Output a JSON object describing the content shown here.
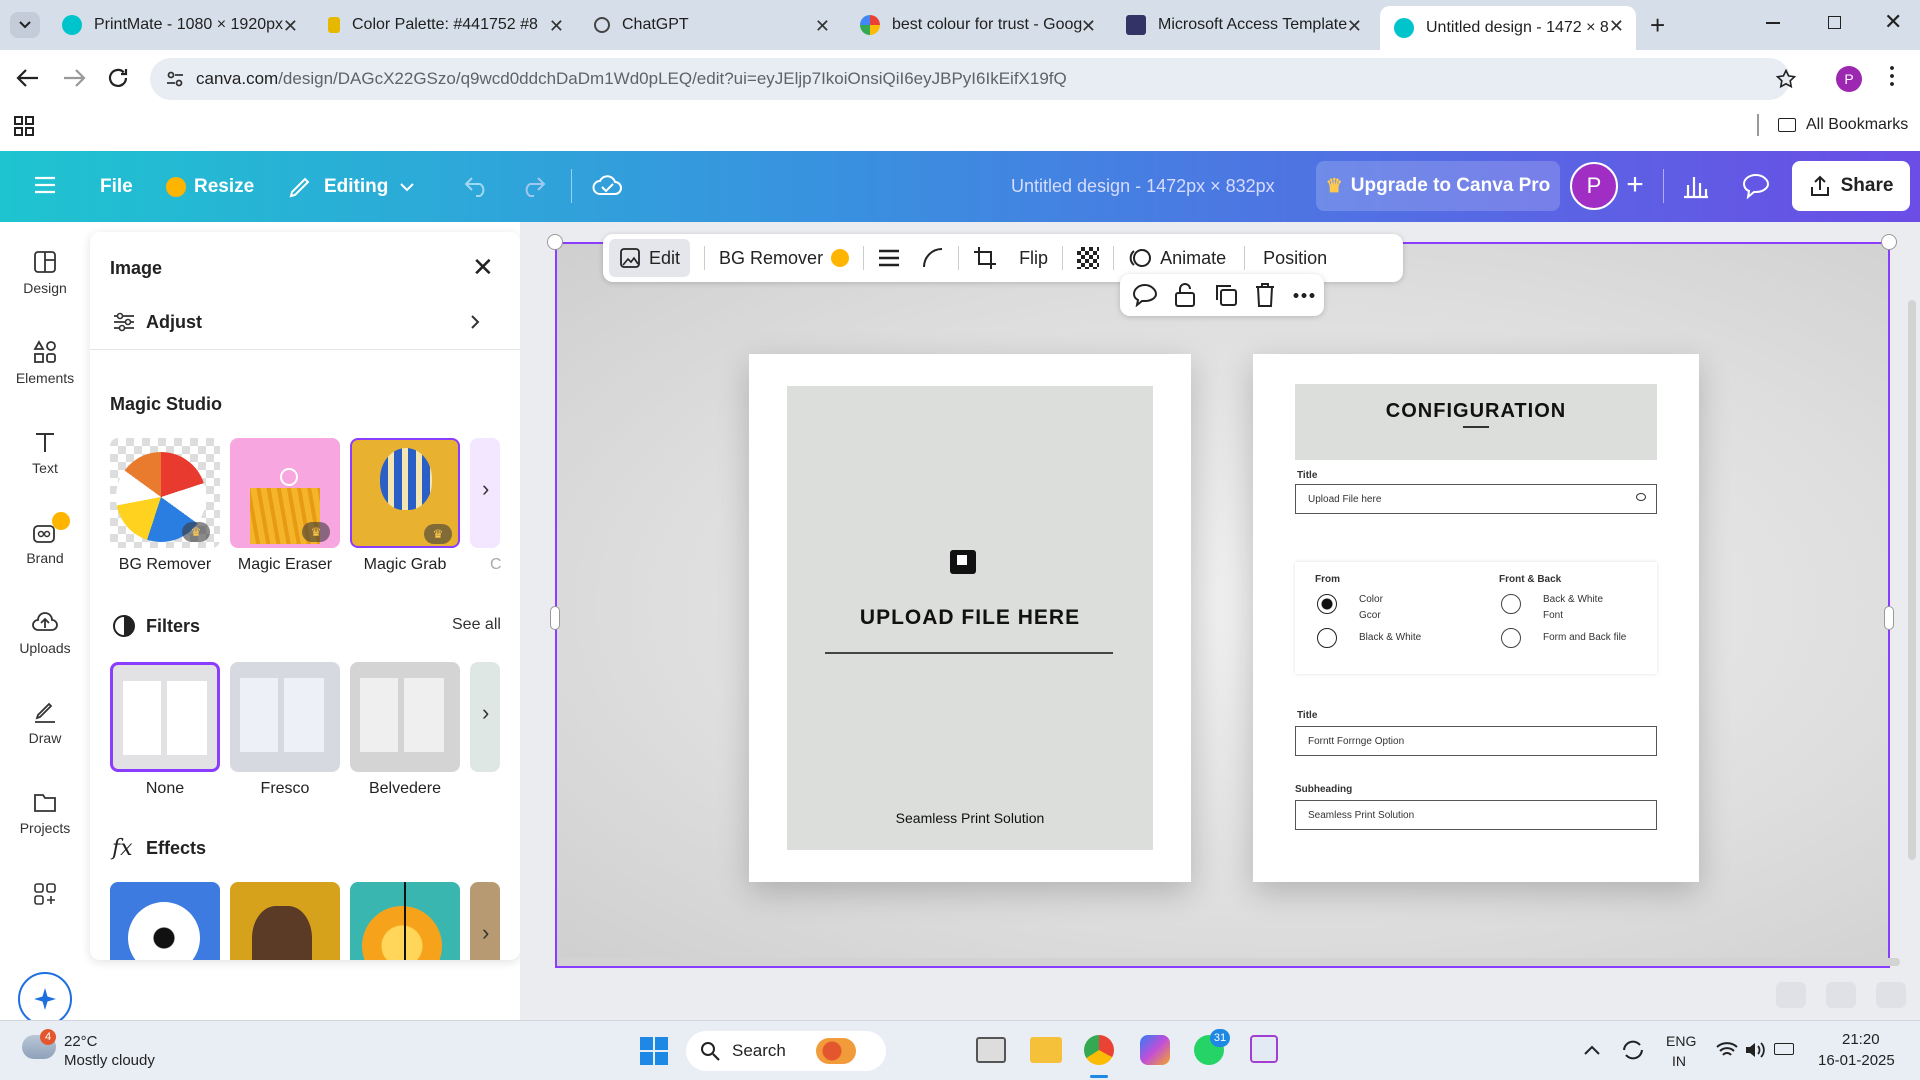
{
  "browser": {
    "tabs": [
      {
        "title": "PrintMate - 1080 × 1920px",
        "color": "#00c4cc"
      },
      {
        "title": "Color Palette: #441752 #8",
        "color": "#e6b800"
      },
      {
        "title": "ChatGPT",
        "color": "#444444"
      },
      {
        "title": "best colour for trust - Goog",
        "color": "#4285f4"
      },
      {
        "title": "Microsoft Access Template",
        "color": "#333366"
      },
      {
        "title": "Untitled design - 1472 × 8",
        "color": "#00c4cc"
      }
    ],
    "url_host": "canva.com",
    "url_path": "/design/DAGcX22GSzo/q9wcd0ddchDaDm1Wd0pLEQ/edit?ui=eyJEljp7IkoiOnsiQiI6eyJBPyI6IkEifX19fQ",
    "bookmarks_label": "All Bookmarks",
    "profile_initial": "P"
  },
  "canva_header": {
    "file": "File",
    "resize": "Resize",
    "editing": "Editing",
    "design_title": "Untitled design - 1472px × 832px",
    "upgrade": "Upgrade to Canva Pro",
    "avatar": "P",
    "share": "Share"
  },
  "rail": [
    "Design",
    "Elements",
    "Text",
    "Brand",
    "Uploads",
    "Draw",
    "Projects"
  ],
  "panel": {
    "title": "Image",
    "adjust": "Adjust",
    "magic_studio": "Magic Studio",
    "magic_items": [
      "BG Remover",
      "Magic Eraser",
      "Magic Grab",
      "C"
    ],
    "filters": "Filters",
    "see_all": "See all",
    "filter_items": [
      "None",
      "Fresco",
      "Belvedere"
    ],
    "effects": "Effects"
  },
  "toolbar": {
    "edit": "Edit",
    "bg_remover": "BG Remover",
    "flip": "Flip",
    "animate": "Animate",
    "position": "Position"
  },
  "design": {
    "left_card": {
      "upload": "UPLOAD FILE HERE",
      "footer": "Seamless Print Solution"
    },
    "right_card": {
      "heading": "CONFIGURATION",
      "label1": "Title",
      "field1": "Upload File here",
      "col1_head": "From",
      "col2_head": "Front & Back",
      "opt1": "Color",
      "opt1b": "Gcor",
      "opt2": "Black & White",
      "opt3": "Back & White",
      "opt3b": "Font",
      "opt4": "Form and Back file",
      "label2": "Title",
      "field2": "Forntt Forrnge Option",
      "label3": "Subheading",
      "field3": "Seamless Print Solution"
    }
  },
  "taskbar": {
    "weather_temp": "22°C",
    "weather_desc": "Mostly cloudy",
    "weather_badge": "4",
    "search": "Search",
    "lang1": "ENG",
    "lang2": "IN",
    "time": "21:20",
    "date": "16-01-2025",
    "whatsapp_badge": "31"
  }
}
